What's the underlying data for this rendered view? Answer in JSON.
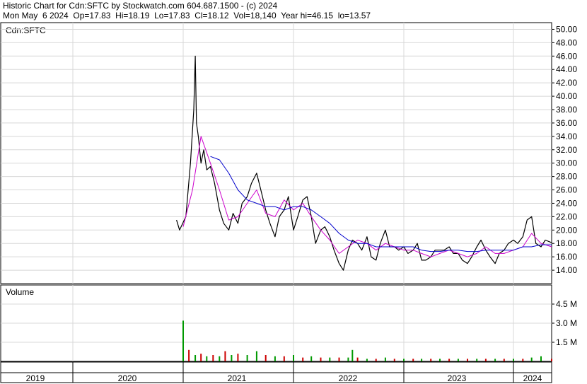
{
  "header": {
    "line1": "Historic Chart for Cdn:SFTC by Stockwatch.com 604.687.1500 - (c) 2024",
    "line2": "Mon May  6 2024  Op=17.83  Hi=18.19  Lo=17.83  Cl=18.12  Vol=18,140  Year hi=46.15  lo=13.57"
  },
  "chart_data": [
    {
      "type": "line",
      "panel": "price",
      "title": "Cdn:SFTC",
      "ylim": [
        12.0,
        51.0
      ],
      "y_ticks": [
        "50.00",
        "48.00",
        "46.00",
        "44.00",
        "42.00",
        "40.00",
        "38.00",
        "36.00",
        "34.00",
        "32.00",
        "30.00",
        "28.00",
        "26.00",
        "24.00",
        "22.00",
        "20.00",
        "18.00",
        "16.00",
        "14.00"
      ],
      "x_labels": [
        "2019",
        "2020",
        "2021",
        "2022",
        "2023",
        "2024"
      ],
      "grid": true,
      "series": [
        {
          "color": "#000000",
          "x": [
            "2020-12-10",
            "2020-12-20",
            "2021-01-10",
            "2021-01-25",
            "2021-02-05",
            "2021-02-10",
            "2021-02-14",
            "2021-02-20",
            "2021-03-01",
            "2021-03-10",
            "2021-03-20",
            "2021-04-01",
            "2021-04-15",
            "2021-05-01",
            "2021-05-15",
            "2021-06-01",
            "2021-06-15",
            "2021-07-01",
            "2021-07-15",
            "2021-08-01",
            "2021-08-15",
            "2021-09-01",
            "2021-09-15",
            "2021-10-01",
            "2021-10-15",
            "2021-11-01",
            "2021-11-15",
            "2021-12-01",
            "2021-12-15",
            "2022-01-01",
            "2022-01-15",
            "2022-02-01",
            "2022-02-15",
            "2022-03-01",
            "2022-03-15",
            "2022-04-01",
            "2022-04-15",
            "2022-05-01",
            "2022-05-15",
            "2022-06-01",
            "2022-06-15",
            "2022-07-01",
            "2022-07-15",
            "2022-08-01",
            "2022-08-15",
            "2022-09-01",
            "2022-09-15",
            "2022-10-01",
            "2022-10-15",
            "2022-11-01",
            "2022-11-15",
            "2022-12-01",
            "2022-12-15",
            "2023-01-01",
            "2023-01-15",
            "2023-02-01",
            "2023-02-15",
            "2023-03-01",
            "2023-03-15",
            "2023-04-01",
            "2023-04-15",
            "2023-05-01",
            "2023-05-15",
            "2023-06-01",
            "2023-06-15",
            "2023-07-01",
            "2023-07-15",
            "2023-08-01",
            "2023-08-15",
            "2023-09-01",
            "2023-09-15",
            "2023-10-01",
            "2023-10-15",
            "2023-11-01",
            "2023-11-15",
            "2023-12-01",
            "2023-12-15",
            "2024-01-01",
            "2024-01-15",
            "2024-02-01",
            "2024-02-15",
            "2024-03-01",
            "2024-03-15",
            "2024-04-01",
            "2024-04-15",
            "2024-05-06"
          ],
          "values": [
            21.5,
            20.0,
            22.0,
            30.0,
            38.0,
            46.0,
            36.0,
            34.0,
            30.0,
            32.0,
            29.0,
            29.5,
            27.0,
            23.0,
            21.0,
            20.0,
            22.5,
            21.0,
            24.0,
            25.0,
            27.0,
            28.5,
            26.0,
            23.0,
            21.0,
            19.0,
            22.0,
            23.0,
            25.0,
            20.0,
            22.0,
            24.5,
            25.0,
            22.0,
            18.0,
            20.0,
            20.5,
            19.0,
            17.0,
            15.0,
            14.0,
            17.0,
            18.5,
            18.0,
            17.0,
            19.0,
            16.0,
            15.5,
            18.0,
            20.0,
            17.5,
            17.5,
            17.0,
            17.5,
            16.5,
            17.0,
            18.0,
            15.5,
            15.5,
            16.0,
            17.0,
            17.0,
            17.0,
            17.5,
            16.5,
            16.5,
            15.5,
            15.0,
            16.0,
            17.5,
            18.5,
            17.0,
            16.0,
            15.0,
            16.5,
            17.0,
            18.0,
            18.5,
            18.0,
            19.0,
            21.5,
            22.0,
            18.0,
            17.5,
            18.5,
            18.12
          ]
        },
        {
          "color": "#cc00cc",
          "x": [
            "2021-01-01",
            "2021-02-01",
            "2021-03-01",
            "2021-04-01",
            "2021-05-01",
            "2021-06-01",
            "2021-07-01",
            "2021-08-01",
            "2021-09-01",
            "2021-10-01",
            "2021-11-01",
            "2021-12-01",
            "2022-01-01",
            "2022-02-01",
            "2022-03-01",
            "2022-04-01",
            "2022-05-01",
            "2022-06-01",
            "2022-07-01",
            "2022-08-01",
            "2022-09-01",
            "2022-10-01",
            "2022-11-01",
            "2022-12-01",
            "2023-01-01",
            "2023-02-01",
            "2023-03-01",
            "2023-04-01",
            "2023-05-01",
            "2023-06-01",
            "2023-07-01",
            "2023-08-01",
            "2023-09-01",
            "2023-10-01",
            "2023-11-01",
            "2023-12-01",
            "2024-01-01",
            "2024-02-01",
            "2024-03-01",
            "2024-04-01",
            "2024-05-06"
          ],
          "values": [
            20.5,
            26.0,
            34.0,
            30.0,
            26.0,
            21.5,
            22.0,
            24.0,
            26.0,
            22.5,
            22.0,
            24.5,
            23.0,
            24.0,
            22.0,
            20.0,
            18.5,
            16.5,
            17.5,
            18.5,
            18.0,
            17.0,
            18.0,
            17.5,
            17.0,
            17.0,
            16.5,
            16.0,
            16.5,
            17.0,
            16.5,
            16.0,
            16.5,
            17.5,
            16.5,
            16.5,
            17.0,
            17.5,
            19.5,
            18.0,
            17.5
          ]
        },
        {
          "color": "#0000cc",
          "x": [
            "2021-04-01",
            "2021-05-01",
            "2021-06-01",
            "2021-07-01",
            "2021-08-01",
            "2021-09-01",
            "2021-10-01",
            "2021-11-01",
            "2021-12-01",
            "2022-01-01",
            "2022-02-01",
            "2022-03-01",
            "2022-04-01",
            "2022-05-01",
            "2022-06-01",
            "2022-07-01",
            "2022-08-01",
            "2022-09-01",
            "2022-10-01",
            "2022-11-01",
            "2022-12-01",
            "2023-01-01",
            "2023-02-01",
            "2023-03-01",
            "2023-04-01",
            "2023-05-01",
            "2023-06-01",
            "2023-07-01",
            "2023-08-01",
            "2023-09-01",
            "2023-10-01",
            "2023-11-01",
            "2023-12-01",
            "2024-01-01",
            "2024-02-01",
            "2024-03-01",
            "2024-04-01",
            "2024-05-06"
          ],
          "values": [
            31.0,
            30.5,
            28.5,
            26.0,
            24.5,
            24.0,
            23.5,
            23.5,
            23.0,
            23.5,
            23.5,
            23.0,
            22.0,
            21.0,
            19.5,
            18.5,
            18.0,
            18.0,
            17.5,
            17.5,
            17.5,
            17.5,
            17.5,
            17.0,
            16.8,
            16.8,
            17.0,
            17.0,
            16.8,
            16.8,
            17.0,
            17.0,
            17.0,
            17.0,
            17.5,
            17.5,
            17.8,
            17.8
          ]
        }
      ]
    },
    {
      "type": "bar",
      "panel": "volume",
      "title": "Volume",
      "ylim": [
        0,
        6.0
      ],
      "y_ticks": [
        "4.5 M",
        "3.0 M",
        "1.5 M"
      ],
      "x": [
        "2021-01-01",
        "2021-01-20",
        "2021-02-10",
        "2021-03-01",
        "2021-03-20",
        "2021-04-10",
        "2021-05-01",
        "2021-05-20",
        "2021-06-10",
        "2021-07-01",
        "2021-08-01",
        "2021-09-01",
        "2021-10-01",
        "2021-11-01",
        "2021-12-01",
        "2022-01-01",
        "2022-02-01",
        "2022-03-01",
        "2022-04-01",
        "2022-05-01",
        "2022-06-01",
        "2022-07-01",
        "2022-07-15",
        "2022-08-01",
        "2022-09-01",
        "2022-10-01",
        "2022-11-01",
        "2022-12-01",
        "2023-01-01",
        "2023-02-01",
        "2023-03-01",
        "2023-04-01",
        "2023-05-01",
        "2023-06-01",
        "2023-07-01",
        "2023-08-01",
        "2023-09-01",
        "2023-10-01",
        "2023-11-01",
        "2023-12-01",
        "2024-01-01",
        "2024-02-01",
        "2024-03-01",
        "2024-04-01",
        "2024-05-06"
      ],
      "values": [
        3.2,
        0.9,
        0.5,
        0.6,
        0.4,
        0.5,
        0.4,
        0.8,
        0.5,
        0.6,
        0.5,
        0.8,
        0.5,
        0.4,
        0.4,
        0.5,
        0.3,
        0.4,
        0.3,
        0.3,
        0.3,
        0.3,
        0.9,
        0.3,
        0.2,
        0.2,
        0.3,
        0.2,
        0.2,
        0.2,
        0.2,
        0.2,
        0.2,
        0.2,
        0.2,
        0.2,
        0.2,
        0.2,
        0.2,
        0.2,
        0.2,
        0.2,
        0.3,
        0.4,
        0.2
      ],
      "colors": [
        "#009900",
        "#cc0000",
        "#009900",
        "#cc0000",
        "#009900",
        "#cc0000",
        "#009900",
        "#cc0000",
        "#009900",
        "#cc0000",
        "#009900",
        "#009900",
        "#cc0000",
        "#009900",
        "#cc0000",
        "#009900",
        "#cc0000",
        "#009900",
        "#cc0000",
        "#009900",
        "#cc0000",
        "#009900",
        "#009900",
        "#cc0000",
        "#009900",
        "#cc0000",
        "#009900",
        "#cc0000",
        "#009900",
        "#cc0000",
        "#009900",
        "#cc0000",
        "#009900",
        "#cc0000",
        "#009900",
        "#cc0000",
        "#009900",
        "#cc0000",
        "#009900",
        "#cc0000",
        "#009900",
        "#cc0000",
        "#009900",
        "#009900",
        "#cc0000"
      ]
    }
  ]
}
